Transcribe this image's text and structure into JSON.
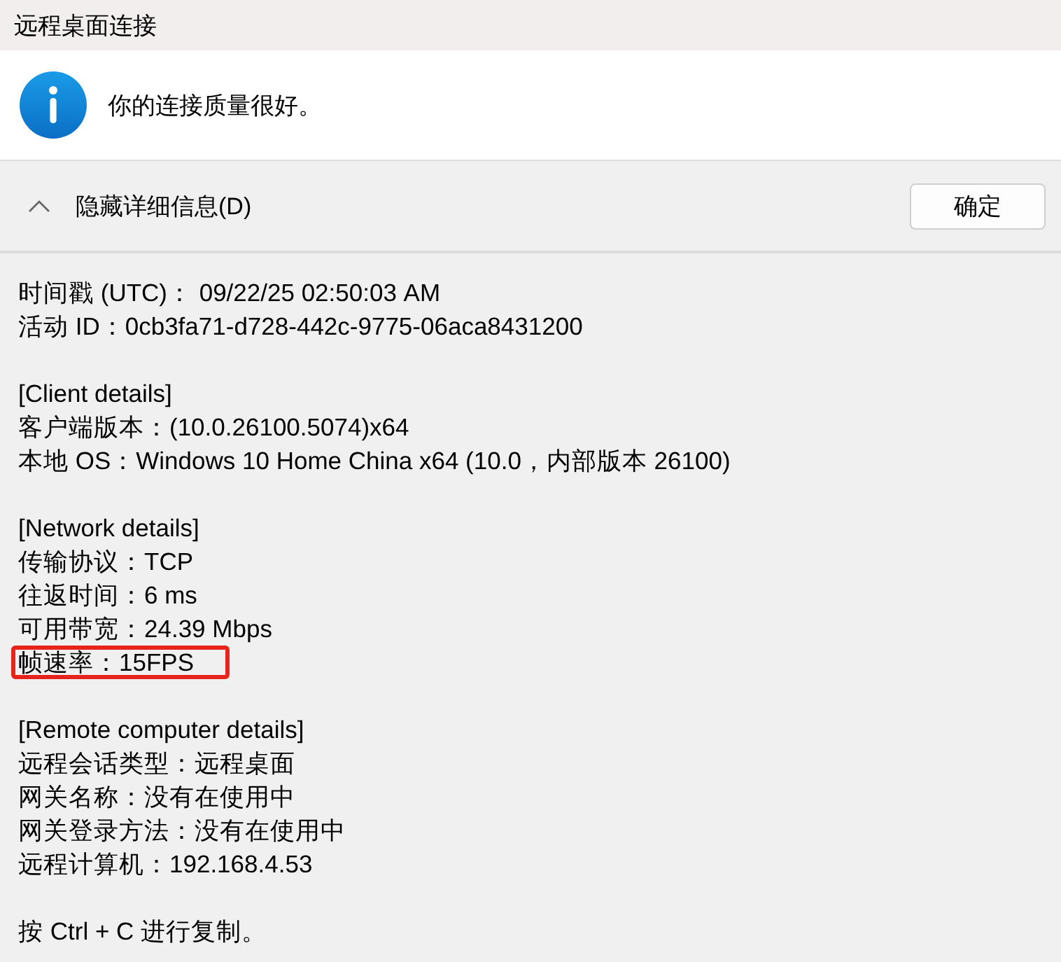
{
  "window": {
    "title": "远程桌面连接"
  },
  "message": {
    "text": "你的连接质量很好。"
  },
  "details_toggle": {
    "label": "隐藏详细信息(D)",
    "expanded": true
  },
  "ok_button": {
    "label": "确定"
  },
  "details": [
    {
      "lines": [
        {
          "text": "时间戳 (UTC)：  09/22/25 02:50:03 AM",
          "highlighted": false
        },
        {
          "text": "活动 ID：0cb3fa71-d728-442c-9775-06aca8431200",
          "highlighted": false
        }
      ]
    },
    {
      "lines": [
        {
          "text": "[Client details]",
          "highlighted": false
        },
        {
          "text": "客户端版本：(10.0.26100.5074)x64",
          "highlighted": false
        },
        {
          "text": "本地 OS：Windows 10 Home China x64 (10.0，内部版本 26100)",
          "highlighted": false
        }
      ]
    },
    {
      "lines": [
        {
          "text": "[Network details]",
          "highlighted": false
        },
        {
          "text": "传输协议：TCP",
          "highlighted": false
        },
        {
          "text": "往返时间：6 ms",
          "highlighted": false
        },
        {
          "text": "可用带宽：24.39 Mbps",
          "highlighted": false
        },
        {
          "text": "帧速率：15FPS",
          "highlighted": true
        }
      ]
    },
    {
      "lines": [
        {
          "text": "[Remote computer details]",
          "highlighted": false
        },
        {
          "text": "远程会话类型：远程桌面",
          "highlighted": false
        },
        {
          "text": "网关名称：没有在使用中",
          "highlighted": false
        },
        {
          "text": "网关登录方法：没有在使用中",
          "highlighted": false
        },
        {
          "text": "远程计算机：192.168.4.53",
          "highlighted": false
        }
      ]
    },
    {
      "lines": [
        {
          "text": "按 Ctrl + C 进行复制。",
          "highlighted": false
        }
      ]
    }
  ]
}
